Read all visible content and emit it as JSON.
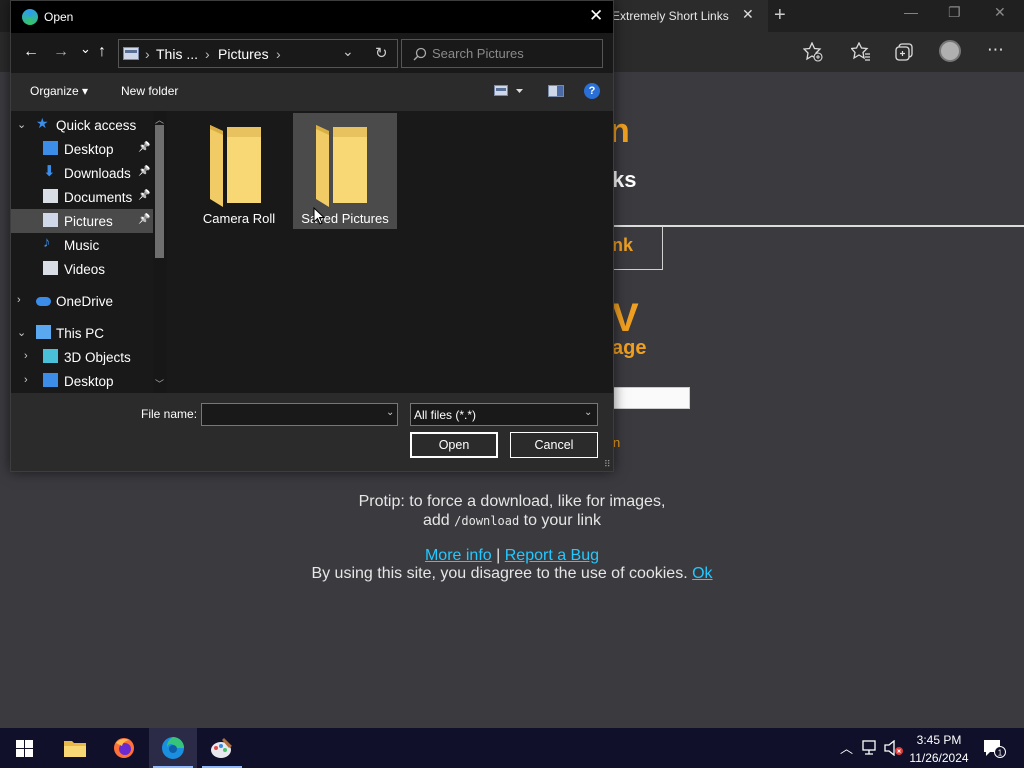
{
  "browser": {
    "tab_title": "Extremely Short Links",
    "tab_close": "✕",
    "new_tab": "+",
    "window_controls": [
      "—",
      "❐",
      "✕"
    ],
    "site": {
      "heading_fragment_1": "n",
      "heading_fragment_2": "ks",
      "link_fragment": "nk",
      "big_fragment": "V",
      "subheading_fragment": "age",
      "orange_fragment_small": "n",
      "protip_line1": "Protip: to force a download, like for images,",
      "protip_line2_pre": "add ",
      "protip_code": "/download",
      "protip_line2_post": " to your link",
      "more_info": "More info",
      "separator": "|",
      "report_bug": "Report a Bug",
      "cookie_text": "By using this site, you disagree to the use of cookies.",
      "cookie_ok": "Ok"
    }
  },
  "dialog": {
    "title": "Open",
    "close": "✕",
    "nav": {
      "back": "←",
      "forward": "→",
      "recent": "⌄",
      "up": "↑",
      "refresh": "↻",
      "dropdown": "⌄"
    },
    "address": {
      "sep1": "›",
      "seg1": "This ...",
      "sep2": "›",
      "seg2": "Pictures",
      "sep3": "›"
    },
    "search_placeholder": "Search Pictures",
    "toolbar": {
      "organize": "Organize ▾",
      "new_folder": "New folder",
      "help": "?"
    },
    "nav_pane": [
      {
        "label": "Quick access",
        "chevron": "⌄",
        "pinned": false,
        "selected": false,
        "icon": "star-icon"
      },
      {
        "label": "Desktop",
        "chevron": "",
        "pinned": true,
        "selected": false,
        "icon": "desktop-icon"
      },
      {
        "label": "Downloads",
        "chevron": "",
        "pinned": true,
        "selected": false,
        "icon": "download-icon"
      },
      {
        "label": "Documents",
        "chevron": "",
        "pinned": true,
        "selected": false,
        "icon": "document-icon"
      },
      {
        "label": "Pictures",
        "chevron": "",
        "pinned": true,
        "selected": true,
        "icon": "pictures-icon"
      },
      {
        "label": "Music",
        "chevron": "",
        "pinned": false,
        "selected": false,
        "icon": "music-icon"
      },
      {
        "label": "Videos",
        "chevron": "",
        "pinned": false,
        "selected": false,
        "icon": "videos-icon"
      },
      {
        "label": "OneDrive",
        "chevron": "›",
        "pinned": false,
        "selected": false,
        "icon": "cloud-icon"
      },
      {
        "label": "This PC",
        "chevron": "⌄",
        "pinned": false,
        "selected": false,
        "icon": "computer-icon"
      },
      {
        "label": "3D Objects",
        "chevron": "›",
        "pinned": false,
        "selected": false,
        "icon": "cube-icon"
      },
      {
        "label": "Desktop",
        "chevron": "›",
        "pinned": false,
        "selected": false,
        "icon": "desktop-icon"
      }
    ],
    "pin_glyph": "📌",
    "folders": [
      {
        "label": "Camera Roll",
        "hovered": false
      },
      {
        "label": "Saved Pictures",
        "hovered": true
      }
    ],
    "file_name_label": "File name:",
    "file_name_value": "",
    "file_type_filter": "All files (*.*)",
    "open_button": "Open",
    "cancel_button": "Cancel"
  },
  "taskbar": {
    "time": "3:45 PM",
    "date": "11/26/2024",
    "apps": [
      "start-icon",
      "file-explorer-icon",
      "firefox-icon",
      "edge-icon",
      "paint-icon"
    ],
    "notification_count": "1"
  },
  "colors": {
    "accent_orange": "#f0a020",
    "link_cyan": "#25c8ff",
    "folder_yellow": "#f8d775",
    "taskbar_bg": "#10102a"
  }
}
